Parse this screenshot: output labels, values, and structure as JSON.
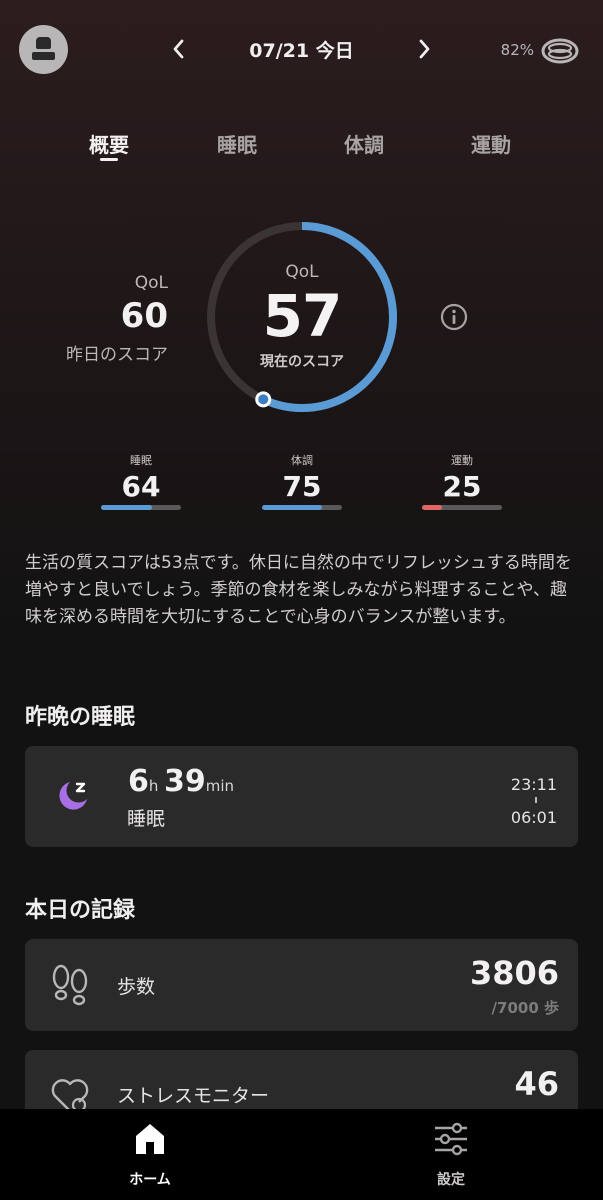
{
  "header": {
    "date_label": "07/21 今日",
    "battery": "82%"
  },
  "tabs": [
    {
      "label": "概要",
      "active": true
    },
    {
      "label": "睡眠",
      "active": false
    },
    {
      "label": "体調",
      "active": false
    },
    {
      "label": "運動",
      "active": false
    }
  ],
  "score": {
    "yesterday_qol": "QoL",
    "yesterday_score": "60",
    "yesterday_label": "昨日のスコア",
    "current_qol": "QoL",
    "current_score": "57",
    "current_label": "現在のスコア",
    "gauge_fraction": 0.57,
    "gauge_color": "#5b9bd5"
  },
  "subscores": [
    {
      "label": "睡眠",
      "value": "64",
      "fraction": 0.64,
      "color": "#5b9bd5"
    },
    {
      "label": "体調",
      "value": "75",
      "fraction": 0.75,
      "color": "#5b9bd5"
    },
    {
      "label": "運動",
      "value": "25",
      "fraction": 0.25,
      "color": "#e06666"
    }
  ],
  "advice": "生活の質スコアは53点です。休日に自然の中でリフレッシュする時間を増やすと良いでしょう。季節の食材を楽しみながら料理することや、趣味を深める時間を大切にすることで心身のバランスが整います。",
  "sleep": {
    "section_title": "昨晩の睡眠",
    "hours": "6",
    "hours_unit": "h",
    "minutes": "39",
    "minutes_unit": "min",
    "label": "睡眠",
    "start": "23:11",
    "end": "06:01",
    "icon": "moon-zz-icon",
    "icon_color": "#a86ee6"
  },
  "records": {
    "section_title": "本日の記録",
    "steps": {
      "label": "歩数",
      "value": "3806",
      "target": "/7000 歩",
      "icon": "footprints-icon"
    },
    "stress": {
      "label": "ストレスモニター",
      "value": "46",
      "icon": "heart-stress-icon"
    }
  },
  "bottom_nav": [
    {
      "label": "ホーム",
      "icon": "home-icon",
      "active": true
    },
    {
      "label": "設定",
      "icon": "sliders-icon",
      "active": false
    }
  ]
}
